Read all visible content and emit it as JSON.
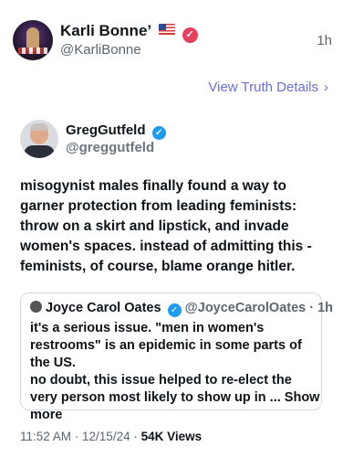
{
  "post": {
    "author_name": "Karli Bonne’",
    "author_handle": "@KarliBonne",
    "time_ago": "1h",
    "view_details_label": "View Truth Details",
    "chevron": "›"
  },
  "embedded": {
    "author_name": "GregGutfeld",
    "author_handle": "@greggutfeld",
    "body": "misogynist males finally found a way to garner protection from leading feminists: throw on a skirt and lipstick, and invade women's spaces. instead of admitting this - feminists, of course, blame orange hitler.",
    "quote": {
      "author_name": "Joyce Carol Oates",
      "author_handle": "@JoyceCarolOates",
      "time": "· 1h",
      "body": "it's a serious issue. \"men in women's restrooms\" is an epidemic in some parts of the US.",
      "body2": "no doubt, this issue helped to re-elect the very person most likely to show up in ...",
      "show_more": "Show more"
    },
    "timestamp": "11:52 AM · 12/15/24 · ",
    "views": "54K",
    "views_label": "Views"
  },
  "colors": {
    "accent_link": "#6b6fd6",
    "verified_blue": "#1d9bf0",
    "verified_pink": "#e83e5c"
  },
  "icons": {
    "flag": "us-flag-icon",
    "verified": "verified-badge-icon"
  }
}
